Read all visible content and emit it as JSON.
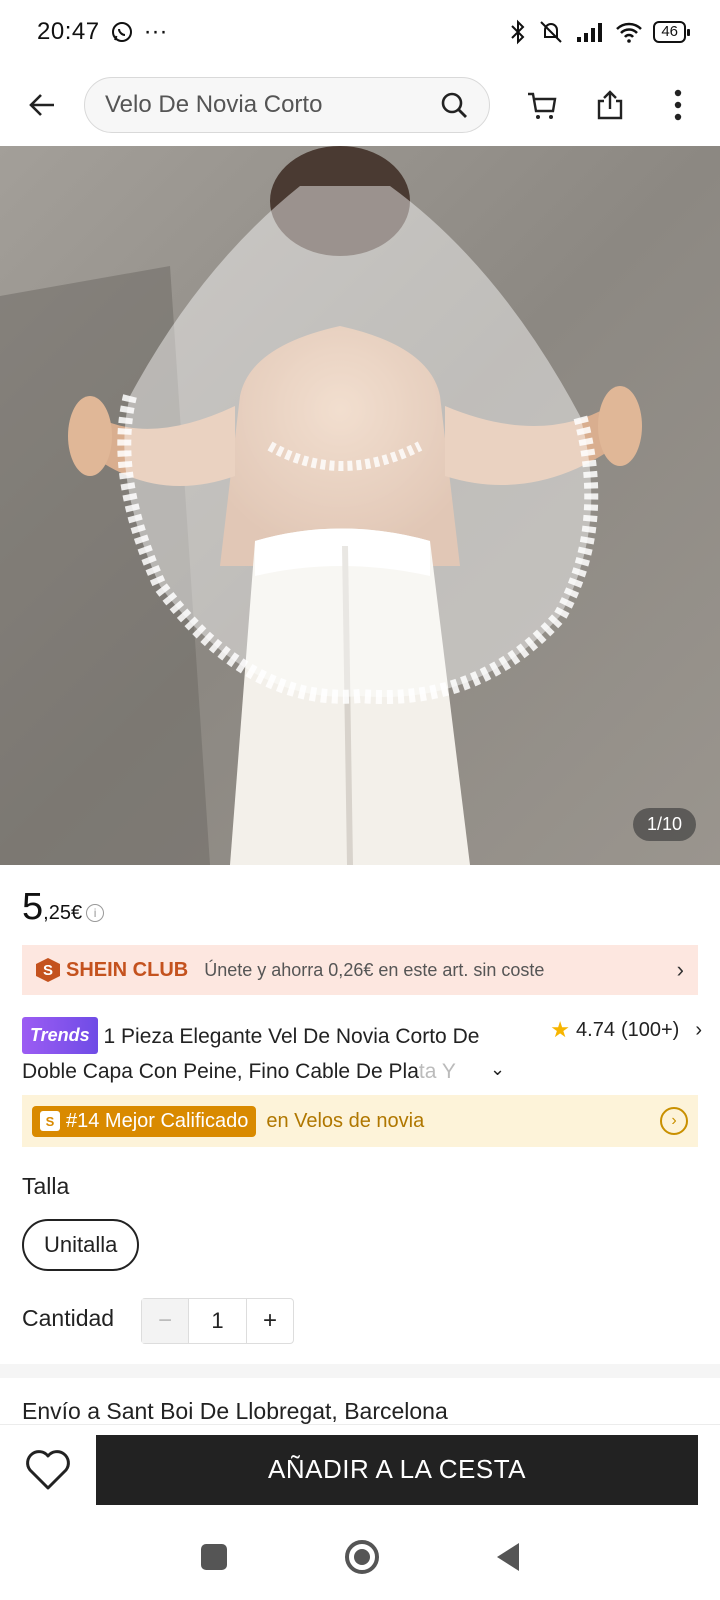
{
  "status_bar": {
    "time": "20:47",
    "more": "···",
    "battery": "46"
  },
  "header": {
    "search_text": "Velo De Novia Corto"
  },
  "gallery": {
    "counter": "1/10"
  },
  "price": {
    "integer": "5",
    "decimal": ",25€"
  },
  "club": {
    "badge": "S",
    "name": "SHEIN CLUB",
    "text": "Únete y ahorra 0,26€ en este art. sin coste"
  },
  "product": {
    "tag": "Trends",
    "title_main": "1 Pieza Elegante Vel De Novia Corto De Doble Capa Con Peine, Fino Cable De Pla",
    "title_fade": "ta Y",
    "rating": "4.74",
    "reviews": "(100+)"
  },
  "rank": {
    "label": "#14 Mejor Calificado",
    "category": "en Velos de novia"
  },
  "size": {
    "label": "Talla",
    "option": "Unitalla"
  },
  "quantity": {
    "label": "Cantidad",
    "value": "1"
  },
  "shipping": {
    "text": "Envío a Sant Boi De Llobregat, Barcelona"
  },
  "actions": {
    "add_to_cart": "AÑADIR A LA CESTA"
  }
}
